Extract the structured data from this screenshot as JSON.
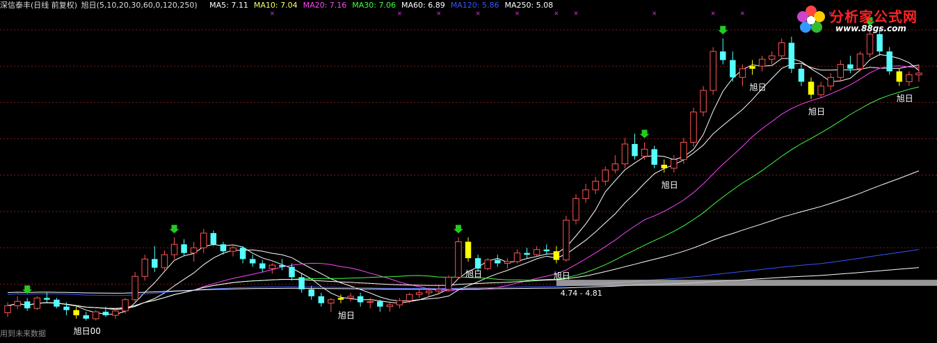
{
  "header": {
    "title": "深信泰丰(日线 前复权)",
    "indicator": "旭日(5,10,20,30,60,0,120,250)",
    "ma": [
      {
        "label": "MA5: 7.11",
        "color": "#ffffff"
      },
      {
        "label": "MA10: 7.04",
        "color": "#ffff66"
      },
      {
        "label": "MA20: 7.16",
        "color": "#ff44ff"
      },
      {
        "label": "MA30: 7.06",
        "color": "#44ff44"
      },
      {
        "label": "MA60: 6.89",
        "color": "#ffffff"
      },
      {
        "label": "MA120: 5.86",
        "color": "#3355ff"
      },
      {
        "label": "MA250: 5.08",
        "color": "#ffffff"
      }
    ]
  },
  "footnote": "用到未来数据",
  "logo": {
    "brand": "分析家公式网",
    "url": "www.88gs.com"
  },
  "colors": {
    "up": "#ff5555",
    "down": "#55ffff",
    "signal": "#ffff00",
    "arrow": "#22cc22",
    "marker": "#cc44cc"
  },
  "chart_data": {
    "type": "candlestick",
    "ylim": [
      4.2,
      7.9
    ],
    "gridlines": [
      7.7,
      7.28,
      6.86,
      6.44,
      6.02,
      5.6,
      5.18,
      4.76
    ],
    "candles": [
      [
        4.43,
        4.55,
        4.38,
        4.51
      ],
      [
        4.51,
        4.62,
        4.47,
        4.56
      ],
      [
        4.56,
        4.6,
        4.45,
        4.48
      ],
      [
        4.48,
        4.62,
        4.46,
        4.6
      ],
      [
        4.6,
        4.66,
        4.55,
        4.58
      ],
      [
        4.58,
        4.6,
        4.48,
        4.5
      ],
      [
        4.5,
        4.55,
        4.4,
        4.46
      ],
      [
        4.46,
        4.5,
        4.36,
        4.4
      ],
      [
        4.4,
        4.44,
        4.34,
        4.36
      ],
      [
        4.36,
        4.46,
        4.34,
        4.44
      ],
      [
        4.44,
        4.5,
        4.38,
        4.4
      ],
      [
        4.4,
        4.48,
        4.36,
        4.45
      ],
      [
        4.45,
        4.6,
        4.42,
        4.58
      ],
      [
        4.58,
        4.9,
        4.55,
        4.85
      ],
      [
        4.85,
        5.1,
        4.8,
        5.05
      ],
      [
        5.05,
        5.2,
        4.9,
        4.95
      ],
      [
        4.95,
        5.15,
        4.92,
        5.1
      ],
      [
        5.1,
        5.3,
        5.05,
        5.22
      ],
      [
        5.22,
        5.28,
        5.08,
        5.12
      ],
      [
        5.12,
        5.25,
        5.02,
        5.18
      ],
      [
        5.18,
        5.4,
        5.12,
        5.35
      ],
      [
        5.35,
        5.38,
        5.2,
        5.22
      ],
      [
        5.22,
        5.25,
        5.1,
        5.14
      ],
      [
        5.14,
        5.22,
        5.08,
        5.18
      ],
      [
        5.18,
        5.2,
        5.0,
        5.05
      ],
      [
        5.05,
        5.1,
        4.96,
        5.0
      ],
      [
        5.0,
        5.04,
        4.9,
        4.94
      ],
      [
        4.94,
        5.0,
        4.88,
        4.98
      ],
      [
        4.98,
        5.05,
        4.92,
        4.96
      ],
      [
        4.96,
        5.0,
        4.8,
        4.84
      ],
      [
        4.84,
        4.88,
        4.66,
        4.7
      ],
      [
        4.7,
        4.74,
        4.58,
        4.62
      ],
      [
        4.62,
        4.66,
        4.5,
        4.54
      ],
      [
        4.54,
        4.6,
        4.44,
        4.58
      ],
      [
        4.58,
        4.64,
        4.54,
        4.6
      ],
      [
        4.6,
        4.66,
        4.56,
        4.62
      ],
      [
        4.62,
        4.66,
        4.5,
        4.55
      ],
      [
        4.55,
        4.6,
        4.48,
        4.56
      ],
      [
        4.56,
        4.58,
        4.44,
        4.5
      ],
      [
        4.5,
        4.56,
        4.44,
        4.52
      ],
      [
        4.52,
        4.6,
        4.48,
        4.57
      ],
      [
        4.57,
        4.66,
        4.54,
        4.64
      ],
      [
        4.64,
        4.7,
        4.6,
        4.66
      ],
      [
        4.66,
        4.72,
        4.62,
        4.68
      ],
      [
        4.68,
        4.74,
        4.64,
        4.7
      ],
      [
        4.7,
        4.86,
        4.68,
        4.84
      ],
      [
        4.84,
        5.3,
        4.82,
        5.25
      ],
      [
        5.25,
        5.3,
        5.02,
        5.06
      ],
      [
        5.06,
        5.1,
        4.9,
        4.94
      ],
      [
        4.94,
        5.06,
        4.92,
        5.04
      ],
      [
        5.04,
        5.1,
        4.96,
        5.0
      ],
      [
        5.0,
        5.06,
        4.94,
        5.02
      ],
      [
        5.02,
        5.16,
        5.0,
        5.12
      ],
      [
        5.12,
        5.18,
        5.06,
        5.1
      ],
      [
        5.1,
        5.2,
        5.08,
        5.16
      ],
      [
        5.16,
        5.22,
        5.1,
        5.14
      ],
      [
        5.14,
        5.2,
        5.0,
        5.04
      ],
      [
        5.04,
        5.55,
        5.02,
        5.5
      ],
      [
        5.5,
        5.8,
        5.45,
        5.75
      ],
      [
        5.75,
        5.92,
        5.7,
        5.85
      ],
      [
        5.85,
        6.0,
        5.8,
        5.95
      ],
      [
        5.95,
        6.12,
        5.9,
        6.08
      ],
      [
        6.08,
        6.25,
        6.04,
        6.15
      ],
      [
        6.15,
        6.45,
        6.1,
        6.38
      ],
      [
        6.38,
        6.5,
        6.2,
        6.24
      ],
      [
        6.24,
        6.4,
        6.2,
        6.32
      ],
      [
        6.32,
        6.36,
        6.1,
        6.14
      ],
      [
        6.14,
        6.2,
        6.05,
        6.1
      ],
      [
        6.1,
        6.25,
        6.05,
        6.2
      ],
      [
        6.2,
        6.45,
        6.15,
        6.4
      ],
      [
        6.4,
        6.8,
        6.35,
        6.75
      ],
      [
        6.75,
        7.05,
        6.7,
        7.0
      ],
      [
        7.0,
        7.5,
        6.95,
        7.45
      ],
      [
        7.45,
        7.6,
        7.3,
        7.35
      ],
      [
        7.35,
        7.45,
        7.1,
        7.15
      ],
      [
        7.15,
        7.3,
        7.05,
        7.25
      ],
      [
        7.25,
        7.35,
        7.18,
        7.28
      ],
      [
        7.28,
        7.4,
        7.22,
        7.36
      ],
      [
        7.36,
        7.45,
        7.3,
        7.4
      ],
      [
        7.4,
        7.6,
        7.36,
        7.55
      ],
      [
        7.55,
        7.62,
        7.2,
        7.25
      ],
      [
        7.25,
        7.3,
        7.05,
        7.1
      ],
      [
        7.1,
        7.15,
        6.9,
        6.95
      ],
      [
        6.95,
        7.1,
        6.92,
        7.05
      ],
      [
        7.05,
        7.2,
        7.0,
        7.15
      ],
      [
        7.15,
        7.35,
        7.1,
        7.3
      ],
      [
        7.3,
        7.4,
        7.2,
        7.25
      ],
      [
        7.25,
        7.45,
        7.22,
        7.42
      ],
      [
        7.42,
        7.7,
        7.38,
        7.65
      ],
      [
        7.65,
        7.72,
        7.4,
        7.45
      ],
      [
        7.45,
        7.5,
        7.18,
        7.22
      ],
      [
        7.22,
        7.25,
        7.05,
        7.1
      ],
      [
        7.1,
        7.22,
        7.05,
        7.18
      ],
      [
        7.18,
        7.3,
        7.1,
        7.2
      ]
    ],
    "ma": [
      {
        "name": "MA5",
        "color": "#ffffff",
        "period": 5
      },
      {
        "name": "MA10",
        "color": "#ffffff",
        "period": 10
      },
      {
        "name": "MA20",
        "color": "#ff44ff",
        "period": 20
      },
      {
        "name": "MA30",
        "color": "#44ff44",
        "period": 30
      },
      {
        "name": "MA60",
        "color": "#ffffff",
        "period": 60
      },
      {
        "name": "MA120",
        "color": "#3355ff",
        "period": 120
      },
      {
        "name": "MA250",
        "color": "#ffffff",
        "period": 250
      }
    ],
    "signals": [
      {
        "index": 7,
        "label": "旭日00"
      },
      {
        "index": 34,
        "label": "旭日"
      },
      {
        "index": 47,
        "label": "旭日"
      },
      {
        "index": 56,
        "label": "旭日"
      },
      {
        "index": 67,
        "label": "旭日"
      },
      {
        "index": 76,
        "label": "旭日"
      },
      {
        "index": 82,
        "label": "旭日"
      },
      {
        "index": 91,
        "label": "旭日"
      }
    ],
    "arrows": [
      2,
      17,
      46,
      65,
      73,
      88
    ],
    "markers": [
      27,
      40,
      44,
      48,
      52,
      56,
      58,
      66,
      72,
      75,
      84,
      86
    ],
    "zone": {
      "label": "4.74 - 4.81",
      "low": 4.74,
      "high": 4.81,
      "start_index": 56
    }
  }
}
